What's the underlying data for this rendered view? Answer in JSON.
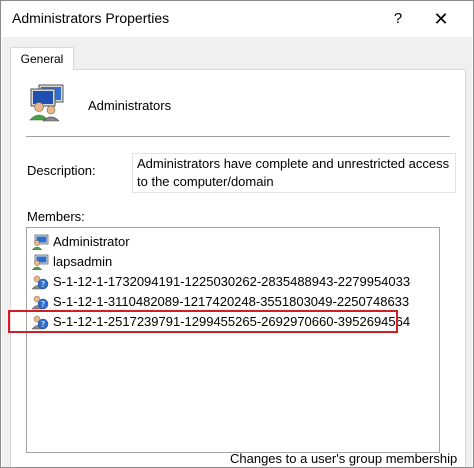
{
  "window": {
    "title": "Administrators Properties",
    "help_glyph": "?",
    "close_glyph": "✕"
  },
  "tabs": [
    {
      "label": "General"
    }
  ],
  "group": {
    "name": "Administrators",
    "icon": "group-icon"
  },
  "description": {
    "label": "Description:",
    "value": "Administrators have complete and unrestricted access to the computer/domain"
  },
  "members": {
    "label": "Members:",
    "items": [
      {
        "name": "Administrator",
        "icon": "user-icon"
      },
      {
        "name": "lapsadmin",
        "icon": "user-icon"
      },
      {
        "name": "S-1-12-1-1732094191-1225030262-2835488943-2279954033",
        "icon": "unknown-user-icon"
      },
      {
        "name": "S-1-12-1-3110482089-1217420248-3551803049-2250748633",
        "icon": "unknown-user-icon"
      },
      {
        "name": "S-1-12-1-2517239791-1299455265-2692970660-3952694564",
        "icon": "unknown-user-icon",
        "highlighted": true
      }
    ]
  },
  "footnote": "Changes to a user's group membership",
  "colors": {
    "highlight": "#d21f27"
  }
}
